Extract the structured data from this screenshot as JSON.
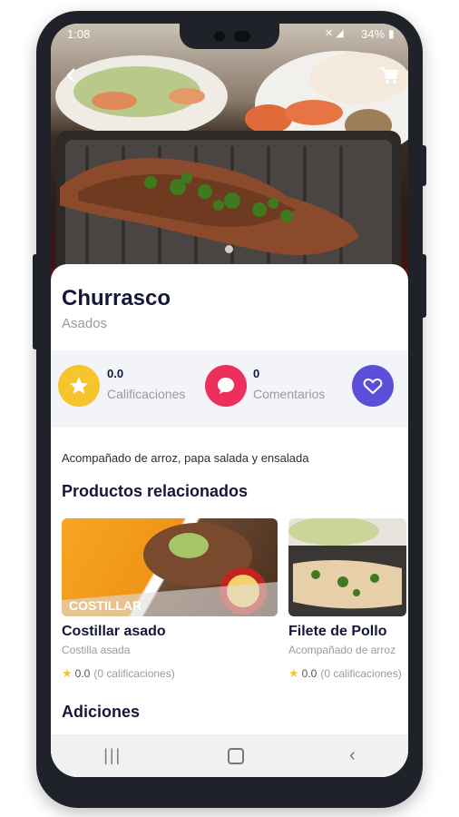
{
  "status": {
    "time": "1:08",
    "battery": "34%"
  },
  "product": {
    "name": "Churrasco",
    "category": "Asados"
  },
  "stats": {
    "ratings_value": "0.0",
    "ratings_label": "Calificaciones",
    "comments_value": "0",
    "comments_label": "Comentarios"
  },
  "description": "Acompañado de arroz, papa salada y ensalada",
  "related": {
    "title": "Productos relacionados",
    "items": [
      {
        "name": "Costillar asado",
        "desc": "Costilla asada",
        "rating": "0.0",
        "rating_count": "(0 calificaciones)",
        "banner": "COSTILLAR"
      },
      {
        "name": "Filete de Pollo",
        "desc": "Acompañado de arroz",
        "rating": "0.0",
        "rating_count": "(0 calificaciones)"
      }
    ]
  },
  "additions_title": "Adiciones",
  "colors": {
    "star_yellow": "#f6c52c",
    "comment_red": "#ec2f5b",
    "heart_purple": "#5b4fd9",
    "title_navy": "#14173a"
  },
  "icons": [
    "back-arrow-icon",
    "cart-icon",
    "star-icon",
    "comment-icon",
    "heart-icon",
    "menu-nav-icon",
    "home-nav-icon",
    "back-nav-icon"
  ]
}
